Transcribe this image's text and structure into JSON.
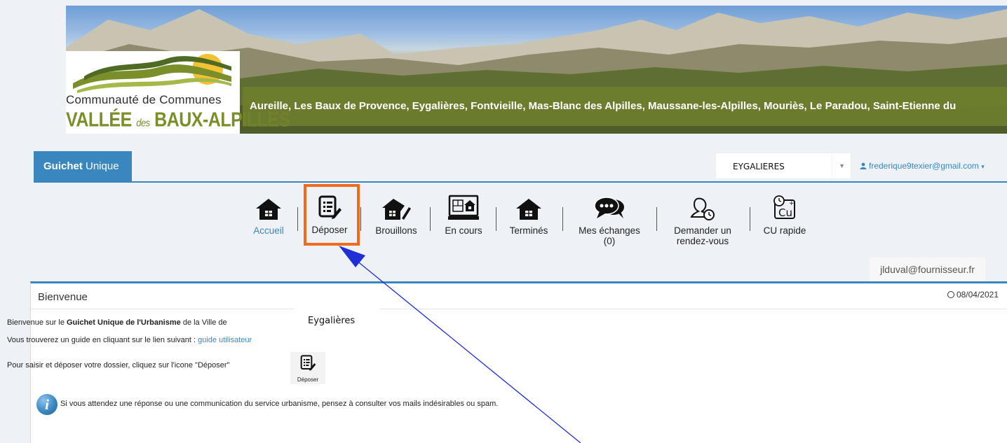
{
  "banner": {
    "logo_line1": "Communauté de Communes",
    "logo_line2_a": "VALLÉE",
    "logo_line2_des": "des",
    "logo_line2_b": "BAUX-ALPILLES",
    "towns": "Aureille, Les Baux de Provence, Eygalières, Fontvieille, Mas-Blanc des Alpilles, Maussane-les-Alpilles, Mouriès, Le Paradou, Saint-Etienne du"
  },
  "nav": {
    "brand_bold": "Guichet",
    "brand_rest": " Unique",
    "commune_value": "EYGALIERES",
    "user_email": "frederique9texier@gmail.com"
  },
  "toolbar": {
    "items": [
      {
        "label": "Accueil",
        "icon": "home-icon"
      },
      {
        "label": "Déposer",
        "icon": "file-edit-icon"
      },
      {
        "label": "Brouillons",
        "icon": "house-pencil-icon"
      },
      {
        "label": "En cours",
        "icon": "plan-monitor-icon"
      },
      {
        "label": "Terminés",
        "icon": "home-icon"
      },
      {
        "label": "Mes échanges",
        "label2": "(0)",
        "icon": "chat-bubbles-icon"
      },
      {
        "label": "Demander un",
        "label2": "rendez-vous",
        "icon": "person-clock-icon"
      },
      {
        "label": "CU rapide",
        "icon": "cu-clock-icon"
      }
    ]
  },
  "email_tag": "jlduval@fournisseur.fr",
  "panel": {
    "title": "Bienvenue",
    "date": "08/04/2021",
    "line1_pre": "Bienvenue sur le ",
    "line1_bold": "Guichet Unique de l'Urbanisme",
    "line1_post": " de la Ville de",
    "ville": "Eygalières",
    "line2_pre": "Vous trouverez un guide en cliquant sur le lien suivant : ",
    "line2_link": "guide utilisateur",
    "line3": "Pour saisir et déposer votre dossier, cliquez sur l'icone \"Déposer\"",
    "mini_deposer": "Déposer",
    "line4": "Si vous attendez une réponse ou une communication du service urbanisme, pensez à consulter vos mails indésirables ou spam."
  },
  "colors": {
    "accent": "#3a87c0",
    "highlight": "#f36a1c",
    "annotation_arrow": "#1f2fd6",
    "banner_bar": "#70802e"
  }
}
